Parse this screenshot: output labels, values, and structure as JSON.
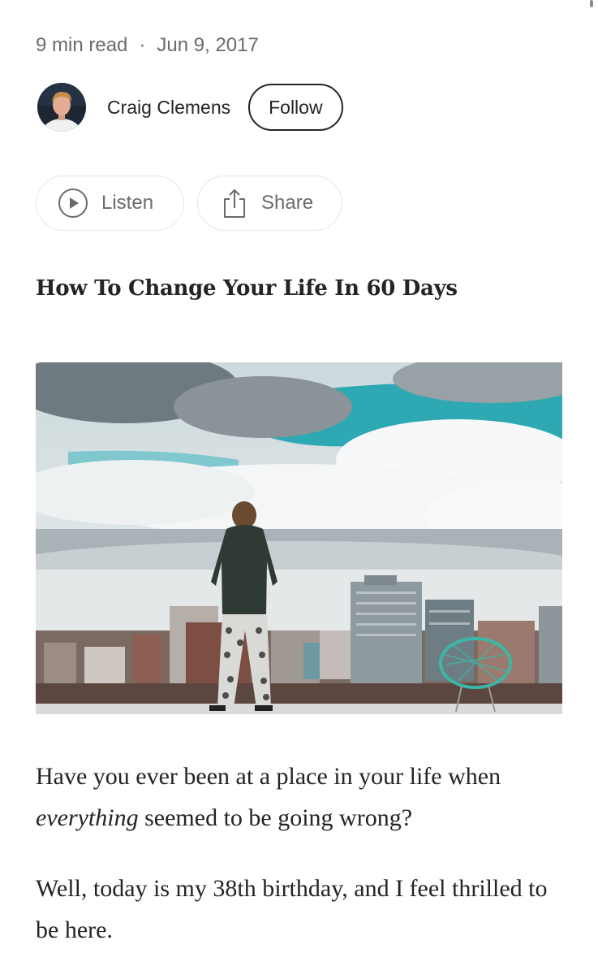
{
  "meta": {
    "read_time": "9 min read",
    "separator": "·",
    "date": "Jun 9, 2017"
  },
  "author": {
    "name": "Craig Clemens",
    "follow_label": "Follow"
  },
  "actions": {
    "listen_label": "Listen",
    "share_label": "Share"
  },
  "article": {
    "title": "How To Change Your Life In 60 Days",
    "p1_before": "Have you ever been at a place in your life when ",
    "p1_emphasis": "everything",
    "p1_after": " seemed to be going wrong?",
    "p2": "Well, today is my 38th birthday, and I feel thrilled to be here."
  },
  "icons": {
    "listen": "play-circle-icon",
    "share": "share-upload-icon"
  },
  "colors": {
    "text": "#242424",
    "muted": "#6b6b6b",
    "border": "#e6e6e6",
    "sky": "#2ea8b3",
    "chair": "#3bb7a8"
  }
}
